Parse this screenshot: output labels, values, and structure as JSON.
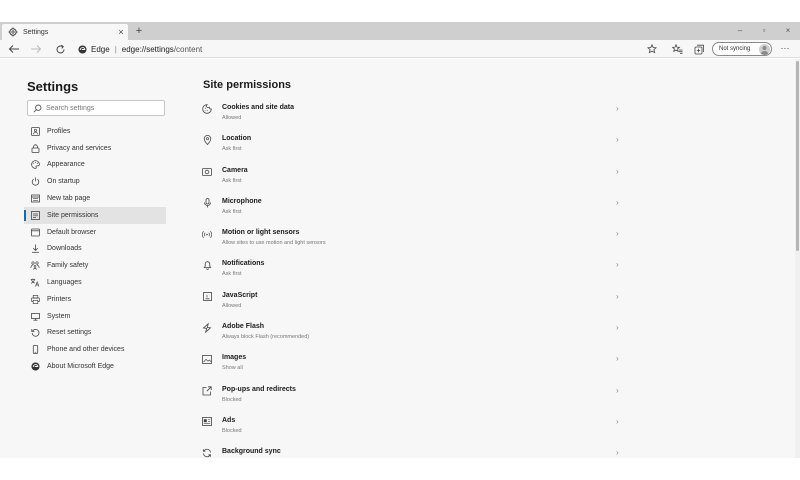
{
  "tab": {
    "title": "Settings",
    "close_glyph": "×",
    "new_tab_glyph": "+"
  },
  "window_controls": {
    "minimize": "–",
    "maximize": "▫",
    "close": "×"
  },
  "address": {
    "edge_label": "Edge",
    "separator": "|",
    "url_host": "edge://settings",
    "url_path": "/content"
  },
  "sync": {
    "label": "Not syncing"
  },
  "more_glyph": "···",
  "sidebar": {
    "title": "Settings",
    "search_placeholder": "Search settings",
    "items": [
      {
        "label": "Profiles",
        "icon": "profile-icon"
      },
      {
        "label": "Privacy and services",
        "icon": "lock-icon"
      },
      {
        "label": "Appearance",
        "icon": "palette-icon"
      },
      {
        "label": "On startup",
        "icon": "power-icon"
      },
      {
        "label": "New tab page",
        "icon": "newtab-icon"
      },
      {
        "label": "Site permissions",
        "icon": "site-permissions-icon",
        "active": true
      },
      {
        "label": "Default browser",
        "icon": "browser-icon"
      },
      {
        "label": "Downloads",
        "icon": "download-icon"
      },
      {
        "label": "Family safety",
        "icon": "family-icon"
      },
      {
        "label": "Languages",
        "icon": "language-icon"
      },
      {
        "label": "Printers",
        "icon": "printer-icon"
      },
      {
        "label": "System",
        "icon": "system-icon"
      },
      {
        "label": "Reset settings",
        "icon": "reset-icon"
      },
      {
        "label": "Phone and other devices",
        "icon": "phone-icon"
      },
      {
        "label": "About Microsoft Edge",
        "icon": "edge-logo-icon"
      }
    ]
  },
  "main": {
    "title": "Site permissions",
    "permissions": [
      {
        "title": "Cookies and site data",
        "subtitle": "Allowed",
        "icon": "cookie-icon"
      },
      {
        "title": "Location",
        "subtitle": "Ask first",
        "icon": "location-icon"
      },
      {
        "title": "Camera",
        "subtitle": "Ask first",
        "icon": "camera-icon"
      },
      {
        "title": "Microphone",
        "subtitle": "Ask first",
        "icon": "microphone-icon"
      },
      {
        "title": "Motion or light sensors",
        "subtitle": "Allow sites to use motion and light sensors",
        "icon": "sensor-icon"
      },
      {
        "title": "Notifications",
        "subtitle": "Ask first",
        "icon": "bell-icon"
      },
      {
        "title": "JavaScript",
        "subtitle": "Allowed",
        "icon": "javascript-icon"
      },
      {
        "title": "Adobe Flash",
        "subtitle": "Always block Flash (recommended)",
        "icon": "flash-icon"
      },
      {
        "title": "Images",
        "subtitle": "Show all",
        "icon": "image-icon"
      },
      {
        "title": "Pop-ups and redirects",
        "subtitle": "Blocked",
        "icon": "popup-icon"
      },
      {
        "title": "Ads",
        "subtitle": "Blocked",
        "icon": "ads-icon"
      },
      {
        "title": "Background sync",
        "subtitle": "",
        "icon": "sync-icon"
      }
    ],
    "chevron_glyph": "›"
  }
}
